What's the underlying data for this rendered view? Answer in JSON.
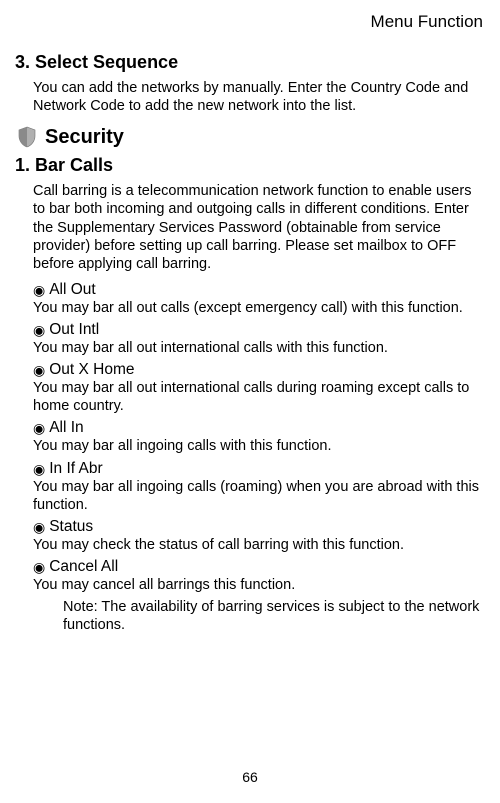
{
  "header": "Menu Function",
  "section1": {
    "title": "3. Select Sequence",
    "body": "You can add the networks by manually.    Enter the Country Code and Network Code to add the new network into the list."
  },
  "security": {
    "title": "Security"
  },
  "barCalls": {
    "title": "1. Bar Calls",
    "intro": "Call barring is a telecommunication network function to enable users to bar both incoming and outgoing calls in different conditions. Enter the Supplementary Services Password (obtainable from service provider) before setting up call barring. Please set mailbox to OFF before applying call barring.",
    "items": [
      {
        "label": "All Out",
        "desc": "You may bar all out calls (except emergency call) with this function."
      },
      {
        "label": "Out Intl",
        "desc": "You may bar all out international calls with this function."
      },
      {
        "label": "Out X Home",
        "desc": "You may bar all out international calls during roaming except calls to home country."
      },
      {
        "label": "All In",
        "desc": "You may bar all ingoing calls with this function."
      },
      {
        "label": "In If Abr",
        "desc": "You may bar all ingoing calls (roaming) when you are abroad with this function."
      },
      {
        "label": "Status",
        "desc": "You may check the status of call barring with this function."
      },
      {
        "label": "Cancel All",
        "desc": "You may cancel all barrings this function."
      }
    ],
    "note": "Note: The availability of barring services is subject to the network functions."
  },
  "pageNumber": "66"
}
